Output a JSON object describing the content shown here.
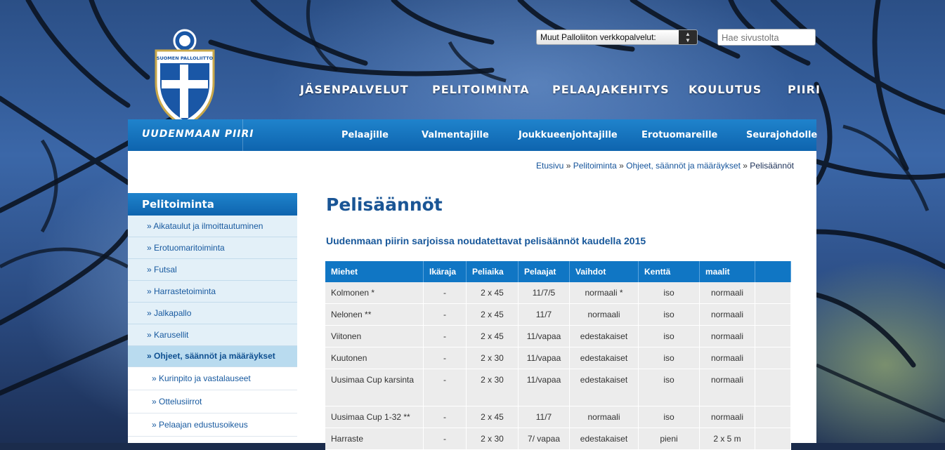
{
  "header": {
    "logo_text": "SUOMEN PALLOLIITTO",
    "services_select": {
      "selected": "Muut Palloliiton verkkopalvelut:"
    },
    "search": {
      "placeholder": "Hae sivustolta"
    },
    "main_nav": [
      {
        "label": "JÄSENPALVELUT"
      },
      {
        "label": "PELITOIMINTA"
      },
      {
        "label": "PELAAJAKEHITYS"
      },
      {
        "label": "KOULUTUS"
      },
      {
        "label": "PIIRI"
      }
    ],
    "district": "UUDENMAAN PIIRI",
    "sub_nav": [
      {
        "label": "Pelaajille"
      },
      {
        "label": "Valmentajille"
      },
      {
        "label": "Joukkueenjohtajille"
      },
      {
        "label": "Erotuomareille"
      },
      {
        "label": "Seurajohdolle"
      }
    ]
  },
  "breadcrumb": {
    "items": [
      "Etusivu",
      "Pelitoiminta",
      "Ohjeet, säännöt ja määräykset"
    ],
    "separator": "»",
    "current": "Pelisäännöt"
  },
  "sidebar": {
    "title": "Pelitoiminta",
    "items": [
      {
        "label": "» Aikataulut ja ilmoittautuminen"
      },
      {
        "label": "» Erotuomaritoiminta"
      },
      {
        "label": "» Futsal"
      },
      {
        "label": "» Harrastetoiminta"
      },
      {
        "label": "» Jalkapallo"
      },
      {
        "label": "» Karusellit"
      },
      {
        "label": "» Ohjeet, säännöt ja määräykset"
      }
    ],
    "subitems": [
      {
        "label": "» Kurinpito ja vastalauseet"
      },
      {
        "label": "» Ottelusiirrot"
      },
      {
        "label": "» Pelaajan edustusoikeus"
      }
    ]
  },
  "main": {
    "title": "Pelisäännöt",
    "subtitle": "Uudenmaan piirin sarjoissa noudatettavat pelisäännöt kaudella 2015",
    "table": {
      "headers": [
        "Miehet",
        "Ikäraja",
        "Peliaika",
        "Pelaajat",
        "Vaihdot",
        "Kenttä",
        "maalit",
        ""
      ],
      "rows": [
        [
          "Kolmonen *",
          "-",
          "2 x 45",
          "11/7/5",
          "normaali *",
          "iso",
          "normaali",
          ""
        ],
        [
          "Nelonen **",
          "-",
          "2 x 45",
          "11/7",
          "normaali",
          "iso",
          "normaali",
          ""
        ],
        [
          "Viitonen",
          "-",
          "2 x 45",
          "11/vapaa",
          "edestakaiset",
          "iso",
          "normaali",
          ""
        ],
        [
          "Kuutonen",
          "-",
          "2 x 30",
          "11/vapaa",
          "edestakaiset",
          "iso",
          "normaali",
          ""
        ],
        [
          "Uusimaa Cup karsinta",
          "-",
          "2 x 30",
          "11/vapaa",
          "edestakaiset",
          "iso",
          "normaali",
          ""
        ],
        [
          "Uusimaa Cup 1-32 **",
          "-",
          "2 x 45",
          "11/7",
          "normaali",
          "iso",
          "normaali",
          ""
        ],
        [
          "Harraste",
          "-",
          "2 x 30",
          "7/ vapaa",
          "edestakaiset",
          "pieni",
          "2 x 5 m",
          ""
        ]
      ]
    }
  }
}
